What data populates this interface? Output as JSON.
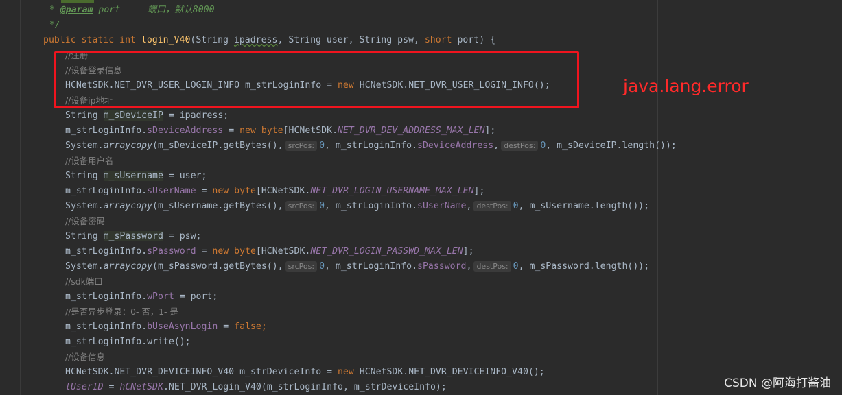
{
  "editor": {
    "doc_param_prefix": " * ",
    "doc_param_tag": "@param",
    "doc_param_name": " port",
    "doc_param_desc": "     端口，默认8000",
    "doc_end": " */",
    "signature": {
      "kw1": "public static int ",
      "name": "login_V40",
      "p1": "(String ",
      "p1name": "ipadress",
      "rest": ", String user, String psw, ",
      "kw_short": "short",
      "end": " port) {"
    },
    "comments": {
      "register": "//注册",
      "login_info": "//设备登录信息",
      "ip": "//设备ip地址",
      "username": "//设备用户名",
      "password": "//设备密码",
      "sdk_port": "//sdk端口",
      "async": "//是否异步登录：0- 否，1- 是",
      "device_info": "//设备信息"
    },
    "lines": {
      "login_info_decl_a": "HCNetSDK.NET_DVR_USER_LOGIN_INFO m_strLoginInfo = ",
      "login_info_decl_new": "new",
      "login_info_decl_b": " HCNetSDK.NET_DVR_USER_LOGIN_INFO();",
      "ip_decl_a": "String ",
      "ip_decl_var": "m_sDeviceIP",
      "ip_decl_b": " = ipadress;",
      "addr_a": "m_strLoginInfo.",
      "addr_field": "sDeviceAddress",
      "addr_b": " = ",
      "addr_new": "new byte",
      "addr_c": "[HCNetSDK.",
      "addr_const": "NET_DVR_DEV_ADDRESS_MAX_LEN",
      "addr_d": "];",
      "copy1_a": "System.",
      "copy1_fn": "arraycopy",
      "copy1_b": "(m_sDeviceIP.getBytes(),",
      "hint_src": "srcPos:",
      "copy1_zero1": "0",
      "copy1_c": ", m_strLoginInfo.",
      "copy1_field": "sDeviceAddress",
      "copy1_d": ",",
      "hint_dest": "destPos:",
      "copy1_zero2": "0",
      "copy1_e": ", m_sDeviceIP.length());",
      "user_decl_var": "m_sUsername",
      "user_decl_b": " = user;",
      "user_field": "sUserName",
      "user_const": "NET_DVR_LOGIN_USERNAME_MAX_LEN",
      "copy2_b": "(m_sUsername.getBytes(),",
      "copy2_e": ", m_sUsername.length());",
      "pwd_decl_var": "m_sPassword",
      "pwd_decl_b": " = psw;",
      "pwd_field": "sPassword",
      "pwd_const": "NET_DVR_LOGIN_PASSWD_MAX_LEN",
      "copy3_b": "(m_sPassword.getBytes(),",
      "copy3_e": ", m_sPassword.length());",
      "port_field": "wPort",
      "port_b": " = port;",
      "async_field": "bUseAsynLogin",
      "async_false": "false",
      "write_b": "write();",
      "dev_a": "HCNetSDK.NET_DVR_DEVICEINFO_V40 m_strDeviceInfo = ",
      "dev_b": " HCNetSDK.NET_DVR_DEVICEINFO_V40();",
      "last_var": "lUserID",
      "last_b": " = ",
      "last_gvar": "hCNetSDK",
      "last_c": ".NET_DVR_Login_V40(m_strLoginInfo, m_strDeviceInfo);"
    }
  },
  "annotation": {
    "error_text": "java.lang.error"
  },
  "watermark": "CSDN @阿海打酱油",
  "colors": {
    "background": "#2b2b2b",
    "keyword": "#cc7832",
    "function": "#ffc66d",
    "field": "#9876aa",
    "comment": "#808080",
    "highlight_box": "#f0141e"
  }
}
